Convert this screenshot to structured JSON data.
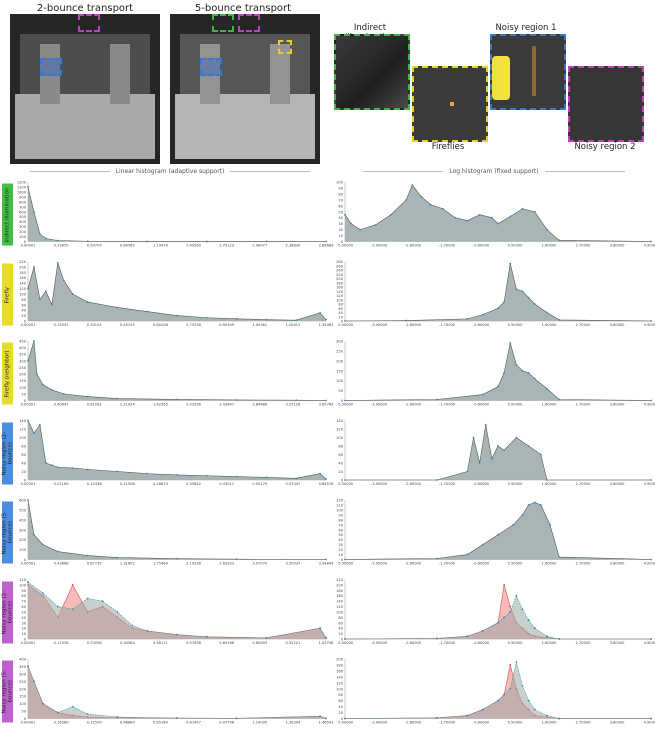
{
  "renders": [
    {
      "title": "2-bounce transport"
    },
    {
      "title": "5-bounce transport"
    }
  ],
  "crops": [
    {
      "label": "Indirect illumination",
      "color": "#3fb54a"
    },
    {
      "label": "Fireflies",
      "color": "#e6d21c"
    },
    {
      "label": "Noisy region 1",
      "color": "#3a78c8"
    },
    {
      "label": "Noisy region 2",
      "color": "#c040c0"
    }
  ],
  "histogram_titles": {
    "linear": "Linear histogram (adaptive support)",
    "log": "Log histogram (fixed support)"
  },
  "row_labels": [
    {
      "text": "Indirect illumination",
      "color": "#40c040"
    },
    {
      "text": "Firefly",
      "color": "#e6dc2a"
    },
    {
      "text": "Firefly (neighbor)",
      "color": "#e6dc2a"
    },
    {
      "text": "Noisy region (2-bounce)",
      "color": "#4a8ee0"
    },
    {
      "text": "Noisy region (5-bounce)",
      "color": "#4a8ee0"
    },
    {
      "text": "Noisy region (2-bounce)",
      "color": "#c060d0"
    },
    {
      "text": "Noisy region (5-bounce)",
      "color": "#c060d0"
    }
  ],
  "colors": {
    "series_red": "#e05050",
    "series_blue": "#2a8ad0",
    "fill": "#9aa8a8",
    "fill_red": "#f08080"
  },
  "chart_data": [
    {
      "type": "area",
      "panel": "linear",
      "row": 0,
      "ylim": [
        0,
        1200
      ],
      "yticks": [
        0,
        100,
        200,
        300,
        400,
        500,
        600,
        700,
        800,
        900,
        1000,
        1100,
        1200
      ],
      "xticks": [
        "0.00001",
        "0.29855",
        "0.59709",
        "0.89562",
        "1.19416",
        "1.49269",
        "1.79123",
        "2.08977",
        "2.38830",
        "2.68684"
      ],
      "x": [
        0,
        0.02,
        0.04,
        0.06,
        0.1,
        0.2,
        0.4,
        0.6,
        0.8,
        1.0
      ],
      "series": [
        {
          "values": [
            1100,
            600,
            150,
            60,
            20,
            5,
            2,
            1,
            1,
            0
          ]
        }
      ]
    },
    {
      "type": "area",
      "panel": "log",
      "row": 0,
      "ylim": [
        0,
        100
      ],
      "yticks": [
        0,
        10,
        20,
        30,
        40,
        50,
        60,
        70,
        80,
        90,
        100
      ],
      "xticks": [
        "-5.00000",
        "-3.90000",
        "-2.80000",
        "-1.70000",
        "-0.60000",
        "0.50000",
        "1.60000",
        "2.70000",
        "3.80000",
        "4.90000"
      ],
      "x": [
        0,
        0.02,
        0.05,
        0.1,
        0.15,
        0.2,
        0.22,
        0.25,
        0.28,
        0.32,
        0.36,
        0.4,
        0.44,
        0.48,
        0.5,
        0.54,
        0.58,
        0.62,
        0.66,
        0.7,
        1.0
      ],
      "series": [
        {
          "values": [
            45,
            30,
            20,
            28,
            45,
            70,
            95,
            75,
            62,
            55,
            40,
            35,
            45,
            40,
            30,
            42,
            55,
            50,
            20,
            2,
            0
          ]
        }
      ]
    },
    {
      "type": "area",
      "panel": "linear",
      "row": 1,
      "ylim": [
        0,
        220
      ],
      "yticks": [
        0,
        20,
        40,
        60,
        80,
        100,
        120,
        140,
        160,
        180,
        200,
        220
      ],
      "xticks": [
        "0.00001",
        "0.15052",
        "0.30104",
        "0.45155",
        "0.60206",
        "0.75258",
        "0.90309",
        "1.05361",
        "1.20411",
        "1.35463"
      ],
      "x": [
        0,
        0.02,
        0.04,
        0.06,
        0.08,
        0.1,
        0.12,
        0.15,
        0.2,
        0.3,
        0.4,
        0.5,
        0.6,
        0.7,
        0.8,
        0.9,
        0.98,
        1.0
      ],
      "series": [
        {
          "name": "",
          "values": [
            120,
            200,
            80,
            110,
            60,
            215,
            150,
            100,
            70,
            50,
            35,
            20,
            12,
            8,
            5,
            3,
            30,
            5
          ]
        }
      ]
    },
    {
      "type": "area",
      "panel": "log",
      "row": 1,
      "ylim": [
        0,
        280
      ],
      "yticks": [
        0,
        20,
        40,
        60,
        80,
        100,
        120,
        140,
        160,
        180,
        200,
        220,
        240,
        260,
        280
      ],
      "xticks": [
        "-5.00000",
        "-3.90000",
        "-2.80000",
        "-1.70000",
        "-0.60000",
        "0.50000",
        "1.60000",
        "2.70000",
        "3.80000",
        "4.90000"
      ],
      "x": [
        0,
        0.2,
        0.4,
        0.45,
        0.5,
        0.52,
        0.54,
        0.56,
        0.58,
        0.6,
        0.62,
        0.66,
        0.7,
        1.0
      ],
      "series": [
        {
          "values": [
            0,
            2,
            10,
            30,
            60,
            90,
            270,
            150,
            140,
            110,
            80,
            40,
            5,
            0
          ]
        }
      ]
    },
    {
      "type": "area",
      "panel": "linear",
      "row": 2,
      "ylim": [
        0,
        450
      ],
      "yticks": [
        0,
        50,
        100,
        150,
        200,
        250,
        300,
        350,
        400,
        450
      ],
      "xticks": [
        "0.00001",
        "0.40642",
        "0.81282",
        "1.21924",
        "1.62565",
        "2.03206",
        "2.43847",
        "2.84488",
        "3.25126",
        "3.65769"
      ],
      "x": [
        0,
        0.02,
        0.03,
        0.05,
        0.08,
        0.12,
        0.2,
        0.3,
        0.5,
        0.7,
        0.9,
        1.0
      ],
      "series": [
        {
          "values": [
            300,
            450,
            200,
            120,
            80,
            50,
            30,
            15,
            8,
            4,
            2,
            0
          ]
        }
      ]
    },
    {
      "type": "area",
      "panel": "log",
      "row": 2,
      "ylim": [
        0,
        300
      ],
      "yticks": [
        0,
        50,
        100,
        150,
        200,
        250,
        300
      ],
      "xticks": [
        "-5.00000",
        "-3.90000",
        "-2.80000",
        "-1.70000",
        "-0.60000",
        "0.50000",
        "1.60000",
        "2.70000",
        "3.80000",
        "4.90000"
      ],
      "x": [
        0,
        0.3,
        0.45,
        0.5,
        0.52,
        0.54,
        0.56,
        0.58,
        0.6,
        0.62,
        0.66,
        0.7,
        1.0
      ],
      "series": [
        {
          "values": [
            0,
            5,
            30,
            70,
            140,
            290,
            180,
            150,
            140,
            110,
            60,
            5,
            0
          ]
        }
      ]
    },
    {
      "type": "area",
      "panel": "linear",
      "row": 3,
      "ylim": [
        0,
        140
      ],
      "yticks": [
        0,
        20,
        40,
        60,
        80,
        100,
        120,
        140
      ],
      "xticks": [
        "0.00001",
        "0.07169",
        "0.14338",
        "0.21506",
        "0.28674",
        "0.35842",
        "0.43011",
        "0.50179",
        "0.57347",
        "0.64516"
      ],
      "x": [
        0,
        0.02,
        0.04,
        0.06,
        0.08,
        0.1,
        0.15,
        0.2,
        0.3,
        0.4,
        0.5,
        0.6,
        0.7,
        0.8,
        0.9,
        0.98,
        1.0
      ],
      "series": [
        {
          "values": [
            140,
            110,
            130,
            40,
            35,
            30,
            28,
            25,
            20,
            15,
            12,
            10,
            8,
            6,
            4,
            15,
            2
          ]
        }
      ]
    },
    {
      "type": "area",
      "panel": "log",
      "row": 3,
      "ylim": [
        0,
        140
      ],
      "yticks": [
        0,
        20,
        40,
        60,
        80,
        100,
        120,
        140
      ],
      "xticks": [
        "-5.00000",
        "-3.90000",
        "-2.80000",
        "-1.70000",
        "-0.60000",
        "0.50000",
        "1.60000",
        "2.70000",
        "3.80000",
        "4.90000"
      ],
      "x": [
        0,
        0.3,
        0.4,
        0.42,
        0.44,
        0.46,
        0.48,
        0.5,
        0.52,
        0.56,
        0.6,
        0.64,
        0.66,
        1.0
      ],
      "series": [
        {
          "values": [
            0,
            0,
            20,
            100,
            40,
            130,
            50,
            80,
            70,
            100,
            80,
            60,
            0,
            0
          ]
        }
      ]
    },
    {
      "type": "area",
      "panel": "linear",
      "row": 4,
      "ylim": [
        0,
        600
      ],
      "yticks": [
        0,
        100,
        200,
        300,
        400,
        500,
        600
      ],
      "xticks": [
        "0.00001",
        "0.43868",
        "0.87735",
        "1.31602",
        "1.75469",
        "2.19336",
        "2.63203",
        "3.07070",
        "3.50937",
        "3.94804"
      ],
      "x": [
        0,
        0.02,
        0.05,
        0.1,
        0.2,
        0.3,
        0.5,
        0.7,
        1.0
      ],
      "series": [
        {
          "values": [
            600,
            250,
            150,
            80,
            40,
            20,
            8,
            3,
            0
          ]
        }
      ]
    },
    {
      "type": "area",
      "panel": "log",
      "row": 4,
      "ylim": [
        0,
        120
      ],
      "yticks": [
        0,
        10,
        20,
        30,
        40,
        50,
        60,
        70,
        80,
        90,
        100,
        110,
        120
      ],
      "xticks": [
        "-5.00000",
        "-3.90000",
        "-2.80000",
        "-1.70000",
        "-0.60000",
        "0.50000",
        "1.60000",
        "2.70000",
        "3.80000",
        "4.90000"
      ],
      "x": [
        0,
        0.3,
        0.4,
        0.45,
        0.5,
        0.55,
        0.58,
        0.6,
        0.62,
        0.64,
        0.67,
        0.7,
        1.0
      ],
      "series": [
        {
          "values": [
            0,
            2,
            10,
            30,
            50,
            70,
            90,
            110,
            115,
            110,
            70,
            5,
            0
          ]
        }
      ]
    },
    {
      "type": "area",
      "panel": "linear",
      "row": 5,
      "ylim": [
        0,
        110
      ],
      "yticks": [
        0,
        10,
        20,
        30,
        40,
        50,
        60,
        70,
        80,
        90,
        100,
        110
      ],
      "xticks": [
        "0.00001",
        "0.11528",
        "0.23056",
        "0.34584",
        "0.46111",
        "0.57638",
        "0.69166",
        "0.80693",
        "0.92221",
        "1.03748"
      ],
      "x": [
        0,
        0.05,
        0.1,
        0.15,
        0.2,
        0.25,
        0.3,
        0.35,
        0.4,
        0.5,
        0.6,
        0.8,
        0.98,
        1.0
      ],
      "series": [
        {
          "name": "",
          "values": [
            100,
            80,
            40,
            100,
            50,
            60,
            40,
            20,
            15,
            8,
            4,
            2,
            20,
            2
          ]
        },
        {
          "name": "",
          "values": [
            105,
            85,
            60,
            55,
            75,
            70,
            50,
            25,
            15,
            8,
            4,
            2,
            20,
            2
          ]
        }
      ]
    },
    {
      "type": "area",
      "panel": "log",
      "row": 5,
      "ylim": [
        0,
        220
      ],
      "yticks": [
        0,
        20,
        40,
        60,
        80,
        100,
        120,
        140,
        160,
        180,
        200,
        220
      ],
      "xticks": [
        "-5.00000",
        "-3.90000",
        "-2.80000",
        "-1.70000",
        "-0.60000",
        "0.50000",
        "1.60000",
        "2.70000",
        "3.80000",
        "4.90000"
      ],
      "x": [
        0,
        0.3,
        0.4,
        0.45,
        0.5,
        0.52,
        0.54,
        0.56,
        0.58,
        0.6,
        0.62,
        0.66,
        0.7,
        1.0
      ],
      "series": [
        {
          "name": "",
          "values": [
            0,
            2,
            10,
            30,
            60,
            200,
            120,
            60,
            40,
            20,
            10,
            5,
            0,
            0
          ]
        },
        {
          "name": "",
          "values": [
            0,
            2,
            10,
            30,
            60,
            80,
            100,
            160,
            110,
            70,
            40,
            10,
            0,
            0
          ]
        }
      ]
    },
    {
      "type": "area",
      "panel": "linear",
      "row": 6,
      "ylim": [
        0,
        400
      ],
      "yticks": [
        0,
        50,
        100,
        150,
        200,
        250,
        300,
        350,
        400
      ],
      "xticks": [
        "0.00001",
        "0.16380",
        "0.32599",
        "0.48880",
        "0.65180",
        "0.81497",
        "0.97796",
        "1.14095",
        "1.30394",
        "1.46593"
      ],
      "x": [
        0,
        0.02,
        0.05,
        0.1,
        0.15,
        0.2,
        0.3,
        0.5,
        0.7,
        0.98,
        1.0
      ],
      "series": [
        {
          "name": "",
          "values": [
            350,
            250,
            100,
            40,
            20,
            10,
            5,
            2,
            1,
            15,
            1
          ]
        },
        {
          "name": "",
          "values": [
            350,
            250,
            100,
            40,
            80,
            30,
            10,
            3,
            1,
            15,
            1
          ]
        }
      ]
    },
    {
      "type": "area",
      "panel": "log",
      "row": 6,
      "ylim": [
        0,
        200
      ],
      "yticks": [
        0,
        20,
        40,
        60,
        80,
        100,
        120,
        140,
        160,
        180,
        200
      ],
      "xticks": [
        "-5.00000",
        "-3.90000",
        "-2.80000",
        "-1.70000",
        "-0.60000",
        "0.50000",
        "1.60000",
        "2.70000",
        "3.80000",
        "4.90000"
      ],
      "x": [
        0,
        0.3,
        0.4,
        0.45,
        0.5,
        0.52,
        0.54,
        0.56,
        0.58,
        0.6,
        0.62,
        0.66,
        0.7,
        1.0
      ],
      "series": [
        {
          "name": "",
          "values": [
            0,
            2,
            10,
            30,
            60,
            80,
            180,
            100,
            50,
            30,
            10,
            5,
            0,
            0
          ]
        },
        {
          "name": "",
          "values": [
            0,
            2,
            10,
            30,
            60,
            80,
            100,
            190,
            110,
            60,
            30,
            10,
            0,
            0
          ]
        }
      ]
    }
  ]
}
